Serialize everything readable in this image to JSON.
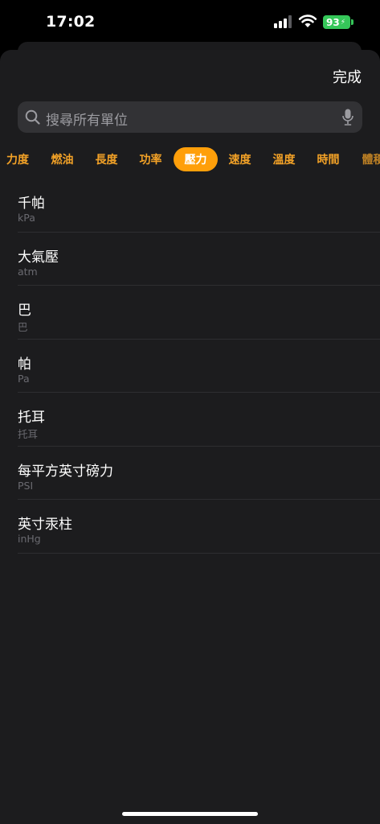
{
  "status": {
    "time": "17:02",
    "battery": "93",
    "accent_battery": "#35c759"
  },
  "header": {
    "done_label": "完成"
  },
  "search": {
    "placeholder": "搜尋所有單位"
  },
  "tabs": [
    {
      "label": "力度",
      "active": false
    },
    {
      "label": "燃油",
      "active": false
    },
    {
      "label": "長度",
      "active": false
    },
    {
      "label": "功率",
      "active": false
    },
    {
      "label": "壓力",
      "active": true
    },
    {
      "label": "速度",
      "active": false
    },
    {
      "label": "溫度",
      "active": false
    },
    {
      "label": "時間",
      "active": false
    },
    {
      "label": "體積",
      "active": false
    }
  ],
  "accent_color": "#ff9f0a",
  "units": [
    {
      "name": "千帕",
      "symbol": "kPa"
    },
    {
      "name": "大氣壓",
      "symbol": "atm"
    },
    {
      "name": "巴",
      "symbol": "巴"
    },
    {
      "name": "帕",
      "symbol": "Pa"
    },
    {
      "name": "托耳",
      "symbol": "托耳"
    },
    {
      "name": "每平方英寸磅力",
      "symbol": "PSI"
    },
    {
      "name": "英寸汞柱",
      "symbol": "inHg"
    }
  ]
}
